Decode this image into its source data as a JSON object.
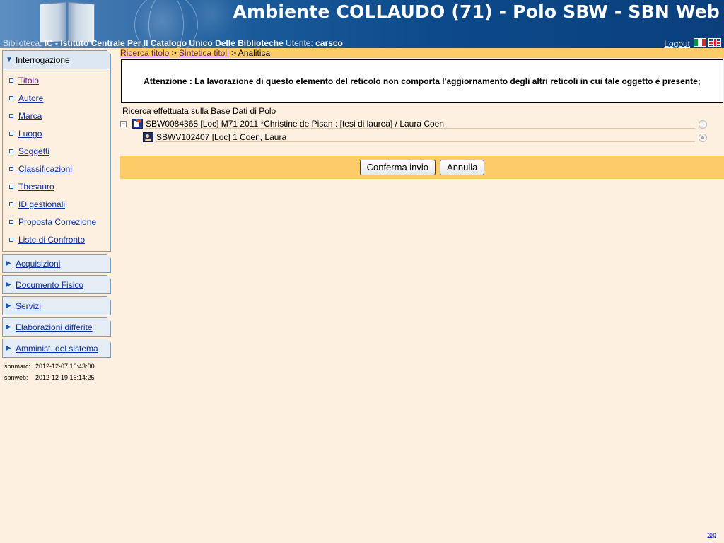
{
  "header": {
    "title": "Ambiente COLLAUDO (71) - Polo SBW - SBN Web",
    "library_label": "Biblioteca:",
    "library_value": "IC - Istituto Centrale Per Il Catalogo Unico Delle Biblioteche",
    "user_label": "Utente:",
    "user_value": "carsco",
    "logout_label": "Logout",
    "flags": [
      "flag-italy-icon",
      "flag-uk-icon"
    ],
    "colors": {
      "banner_dark": "#0a3f7c",
      "banner_light": "#5d8fc2"
    }
  },
  "sidebar": {
    "open_section": "Interrogazione",
    "items": [
      {
        "label": "Titolo",
        "visited": true
      },
      {
        "label": "Autore",
        "visited": false
      },
      {
        "label": "Marca",
        "visited": false
      },
      {
        "label": "Luogo",
        "visited": false
      },
      {
        "label": "Soggetti",
        "visited": false
      },
      {
        "label": "Classificazioni",
        "visited": false
      },
      {
        "label": "Thesauro",
        "visited": false
      },
      {
        "label": "ID gestionali",
        "visited": false
      },
      {
        "label": "Proposta Correzione",
        "visited": false
      },
      {
        "label": "Liste di Confronto",
        "visited": false
      }
    ],
    "sections": [
      "Acquisizioni",
      "Documento Fisico",
      "Servizi",
      "Elaborazioni differite",
      "Amminist. del sistema"
    ],
    "versions": [
      {
        "name": "sbnmarc:",
        "value": "2012-12-07 16:43:00"
      },
      {
        "name": "sbnweb:",
        "value": "2012-12-19 16:14:25"
      }
    ]
  },
  "breadcrumb": {
    "link1": "Ricerca titolo",
    "sep": " > ",
    "link2": "Sintetica titoli",
    "current": "Analitica"
  },
  "warning": "Attenzione : La lavorazione di questo elemento del reticolo non comporta l'aggiornamento degli altri reticoli in cui tale oggetto è presente;",
  "search_note": "Ricerca effettuata sulla Base Dati di Polo",
  "tree": {
    "toggle": "−",
    "root": "SBW0084368 [Loc] M71 2011 *Christine de Pisan : [tesi di laurea] / Laura Coen",
    "child": "SBWV102407 [Loc] 1 Coen, Laura",
    "selected_index": 1
  },
  "buttons": {
    "confirm": "Conferma invio",
    "cancel": "Annulla"
  },
  "footer": {
    "top_link": "top"
  },
  "colors": {
    "page_bg": "#fdf0e0",
    "bar_bg": "#fecc66",
    "link": "#0a2fa8",
    "visited_link": "#5a1a7a"
  }
}
